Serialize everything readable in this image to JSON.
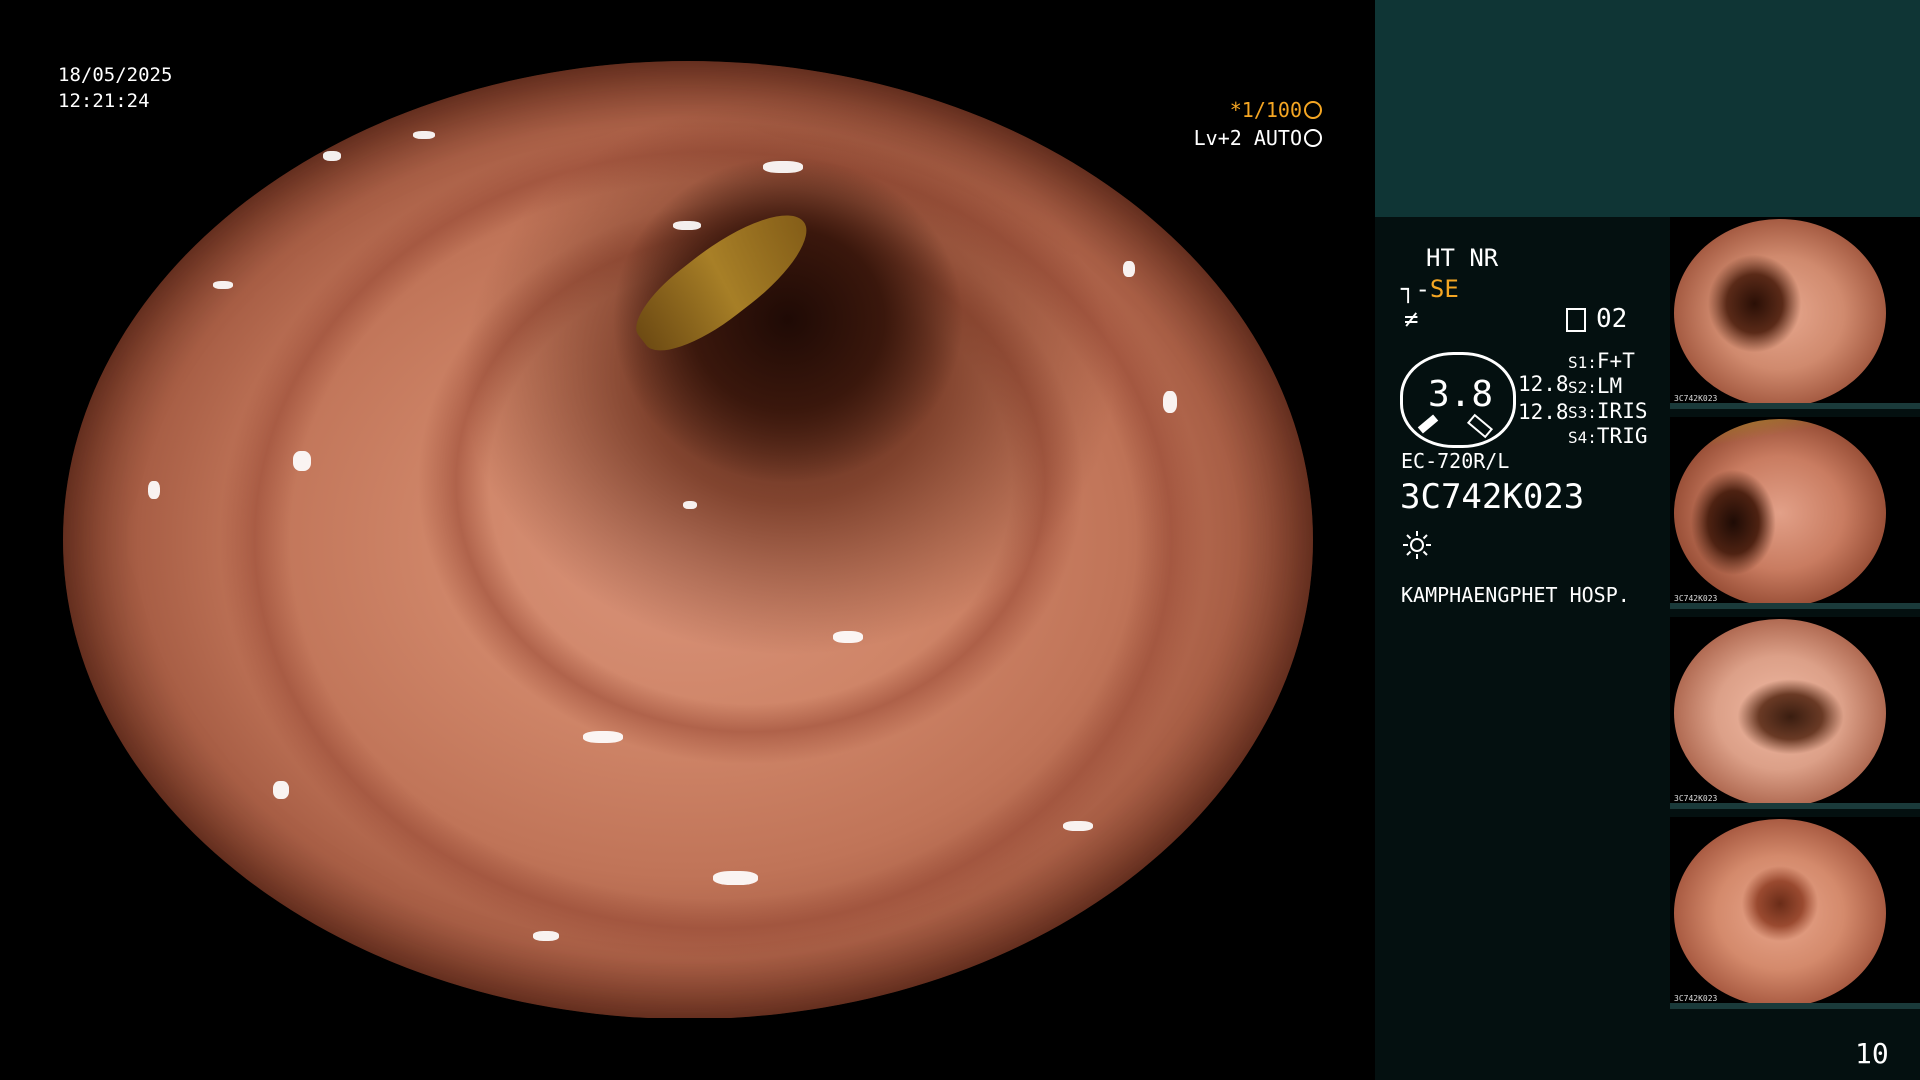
{
  "overlay": {
    "date": "18/05/2025",
    "time": "12:21:24",
    "shutter": "*1/100",
    "level": "Lv+2 AUTO"
  },
  "panel": {
    "ht_nr": "HT NR",
    "se_prefix": "┐‐",
    "se_value": "SE",
    "alt_icon": "≠",
    "mode_value": "02",
    "gauge_value": "3.8",
    "values": [
      "12.8",
      "12.8"
    ],
    "switches": [
      {
        "key": "S1:",
        "value": "F+T"
      },
      {
        "key": "S2:",
        "value": "LM"
      },
      {
        "key": "S3:",
        "value": "IRIS"
      },
      {
        "key": "S4:",
        "value": "TRIG"
      }
    ],
    "scope_model": "EC-720R/L",
    "scope_serial": "3C742K023",
    "hospital": "KAMPHAENGPHET HOSP.",
    "page_number": "10"
  },
  "thumbnails": [
    {
      "label": "3C742K023",
      "icon": "endoscopy-thumbnail"
    },
    {
      "label": "3C742K023",
      "icon": "endoscopy-thumbnail"
    },
    {
      "label": "3C742K023",
      "icon": "endoscopy-thumbnail"
    },
    {
      "label": "3C742K023",
      "icon": "endoscopy-thumbnail"
    }
  ],
  "colors": {
    "accent_orange": "#f5a623",
    "panel_top": "#0f3535",
    "panel_bg": "#041010"
  }
}
